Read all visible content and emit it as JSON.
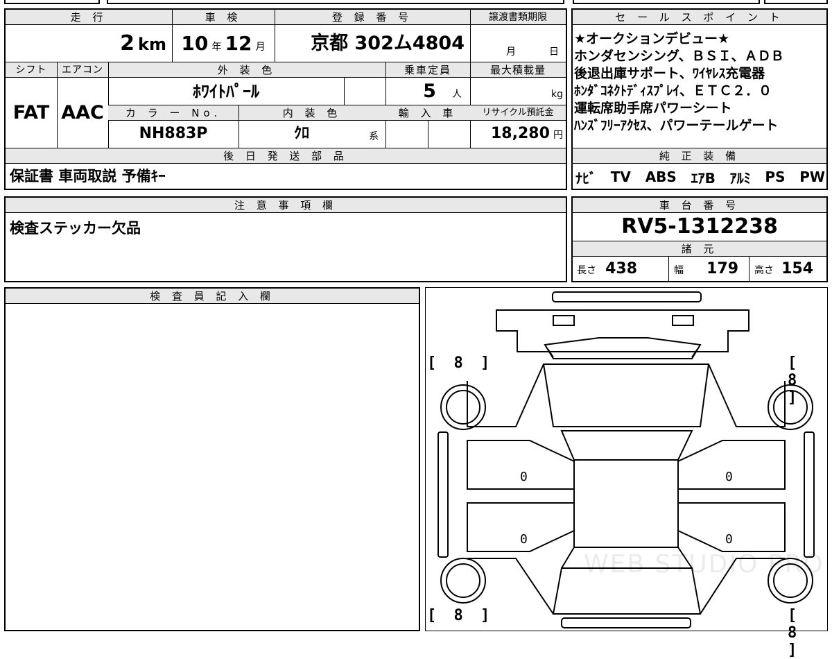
{
  "top_strip": {
    "partial": "・・・"
  },
  "headers": {
    "mileage": "走 行",
    "inspection": "車 検",
    "registration": "登 録 番 号",
    "transfer_deadline": "譲渡書類期限",
    "shift": "シフト",
    "aircon": "エアコン",
    "exterior_color": "外 装 色",
    "capacity": "乗車定員",
    "max_load": "最大積載量",
    "color_no": "カ ラ ー No.",
    "interior_color": "内 装 色",
    "import": "輸 入 車",
    "recycle": "リサイクル預託金",
    "later_parts": "後 日 発 送 部 品",
    "sales_points": "セ ー ル ス ポ イ ン ト",
    "genuine_equipment": "純 正 装 備",
    "notes": "注 意 事 項 欄",
    "chassis_no": "車 台 番 号",
    "specs": "諸 元",
    "inspector": "検 査 員 記 入 欄"
  },
  "vehicle": {
    "mileage_value": "2",
    "mileage_unit": "km",
    "inspection_year": "10",
    "year_unit": "年",
    "inspection_month": "12",
    "month_unit": "月",
    "registration": "京都 302ム4804",
    "deadline_month_unit": "月",
    "deadline_day_unit": "日",
    "shift": "FAT",
    "aircon": "AAC",
    "exterior_color": "ﾎﾜｲﾄﾊﾟｰﾙ",
    "capacity_value": "5",
    "capacity_unit": "人",
    "max_load_unit": "kg",
    "color_no": "NH883P",
    "interior_color": "ｸﾛ",
    "interior_suffix": "系",
    "recycle_value": "18,280",
    "recycle_unit": "円"
  },
  "later_parts_text": "保証書 車両取説 予備ｷｰ",
  "sales_points": [
    "★オークションデビュー★",
    "ホンダセンシング、ＢＳＩ、ＡＤＢ",
    "後退出庫サポート、ﾜｲﾔﾚｽ充電器",
    "ﾎﾝﾀﾞｺﾈｸﾄﾃﾞｨｽﾌﾟﾚｲ、ＥＴＣ２．０",
    "運転席助手席パワーシート",
    "ﾊﾝｽﾞﾌﾘｰｱｸｾｽ、パワーテールゲート"
  ],
  "equipment": [
    "ﾅﾋﾞ",
    "TV",
    "ABS",
    "ｴｱB",
    "ｱﾙﾐ",
    "PS",
    "PW"
  ],
  "notes_text": "検査ステッカー欠品",
  "chassis_no": "RV5-1312238",
  "specs": {
    "length_label": "長さ",
    "length_value": "438",
    "width_label": "幅",
    "width_value": "179",
    "height_label": "高さ",
    "height_value": "154"
  },
  "diagram": {
    "tire_fl": "[ 8 ]",
    "tire_fr": "[ 8 ]",
    "tire_rl": "[ 8 ]",
    "tire_rr": "[ 8 ]",
    "door_fl": "0",
    "door_rl": "0",
    "door_fr": "0",
    "door_rr": "0",
    "watermark": "WEB STUDIO PRO"
  }
}
